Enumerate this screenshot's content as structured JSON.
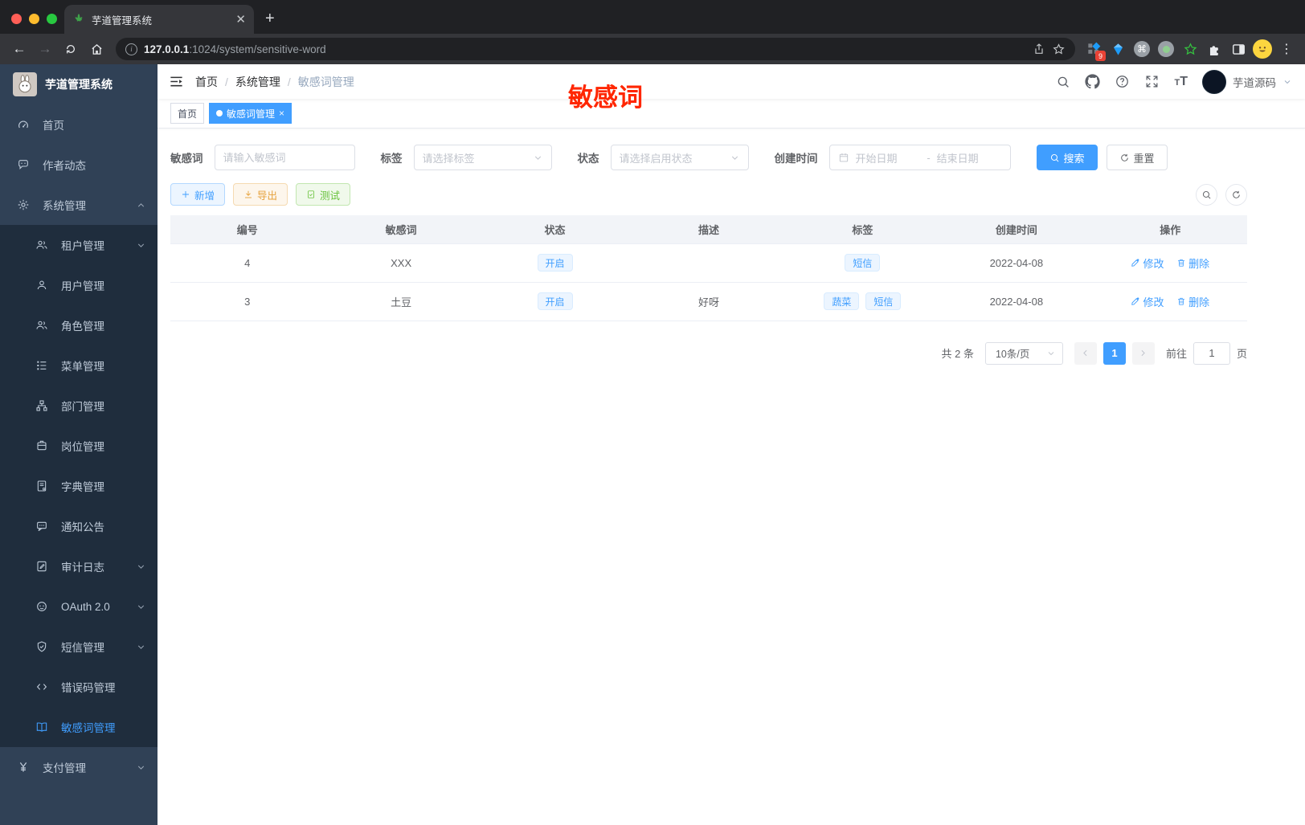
{
  "browser": {
    "tab_title": "芋道管理系统",
    "url_host": "127.0.0.1",
    "url_rest": ":1024/system/sensitive-word",
    "extension_badge": "9"
  },
  "sidebar": {
    "logo_title": "芋道管理系统",
    "items": [
      {
        "label": "首页",
        "icon": "dashboard-icon"
      },
      {
        "label": "作者动态",
        "icon": "chat-icon"
      },
      {
        "label": "系统管理",
        "icon": "gear-icon"
      },
      {
        "label": "租户管理",
        "icon": "tenants-icon"
      },
      {
        "label": "用户管理",
        "icon": "user-icon"
      },
      {
        "label": "角色管理",
        "icon": "roles-icon"
      },
      {
        "label": "菜单管理",
        "icon": "menu-tree-icon"
      },
      {
        "label": "部门管理",
        "icon": "org-icon"
      },
      {
        "label": "岗位管理",
        "icon": "badge-icon"
      },
      {
        "label": "字典管理",
        "icon": "dictionary-icon"
      },
      {
        "label": "通知公告",
        "icon": "announcement-icon"
      },
      {
        "label": "审计日志",
        "icon": "audit-log-icon"
      },
      {
        "label": "OAuth 2.0",
        "icon": "oauth-icon"
      },
      {
        "label": "短信管理",
        "icon": "sms-shield-icon"
      },
      {
        "label": "错误码管理",
        "icon": "error-code-icon"
      },
      {
        "label": "敏感词管理",
        "icon": "sensitive-word-icon"
      },
      {
        "label": "支付管理",
        "icon": "payment-icon"
      }
    ]
  },
  "header": {
    "breadcrumb": {
      "home": "首页",
      "parent": "系统管理",
      "current": "敏感词管理",
      "separator": "/"
    },
    "username": "芋道源码",
    "annotation": "敏感词"
  },
  "tags_view": {
    "home": "首页",
    "active": "敏感词管理"
  },
  "filters": {
    "keyword_label": "敏感词",
    "keyword_placeholder": "请输入敏感词",
    "tag_label": "标签",
    "tag_placeholder": "请选择标签",
    "status_label": "状态",
    "status_placeholder": "请选择启用状态",
    "date_label": "创建时间",
    "date_start_placeholder": "开始日期",
    "date_separator": "-",
    "date_end_placeholder": "结束日期",
    "search_label": "搜索",
    "reset_label": "重置"
  },
  "toolbar": {
    "add_label": "新增",
    "export_label": "导出",
    "test_label": "测试"
  },
  "table": {
    "columns": {
      "id": "编号",
      "word": "敏感词",
      "status": "状态",
      "description": "描述",
      "tags": "标签",
      "created": "创建时间",
      "actions": "操作"
    },
    "rows": [
      {
        "id": "4",
        "word": "XXX",
        "status": "开启",
        "description": "",
        "tags": [
          "短信"
        ],
        "created": "2022-04-08"
      },
      {
        "id": "3",
        "word": "土豆",
        "status": "开启",
        "description": "好呀",
        "tags": [
          "蔬菜",
          "短信"
        ],
        "created": "2022-04-08"
      }
    ],
    "edit_label": "修改",
    "delete_label": "删除"
  },
  "pagination": {
    "total_text": "共 2 条",
    "page_size": "10条/页",
    "current_page": "1",
    "goto_label": "前往",
    "goto_value": "1",
    "page_unit": "页"
  },
  "colors": {
    "primary": "#409eff",
    "warning": "#e6a23c",
    "success": "#67c23a",
    "annotation_red": "#ff2600",
    "sidebar_bg": "#304156",
    "sidebar_submenu_bg": "#1f2d3d"
  }
}
